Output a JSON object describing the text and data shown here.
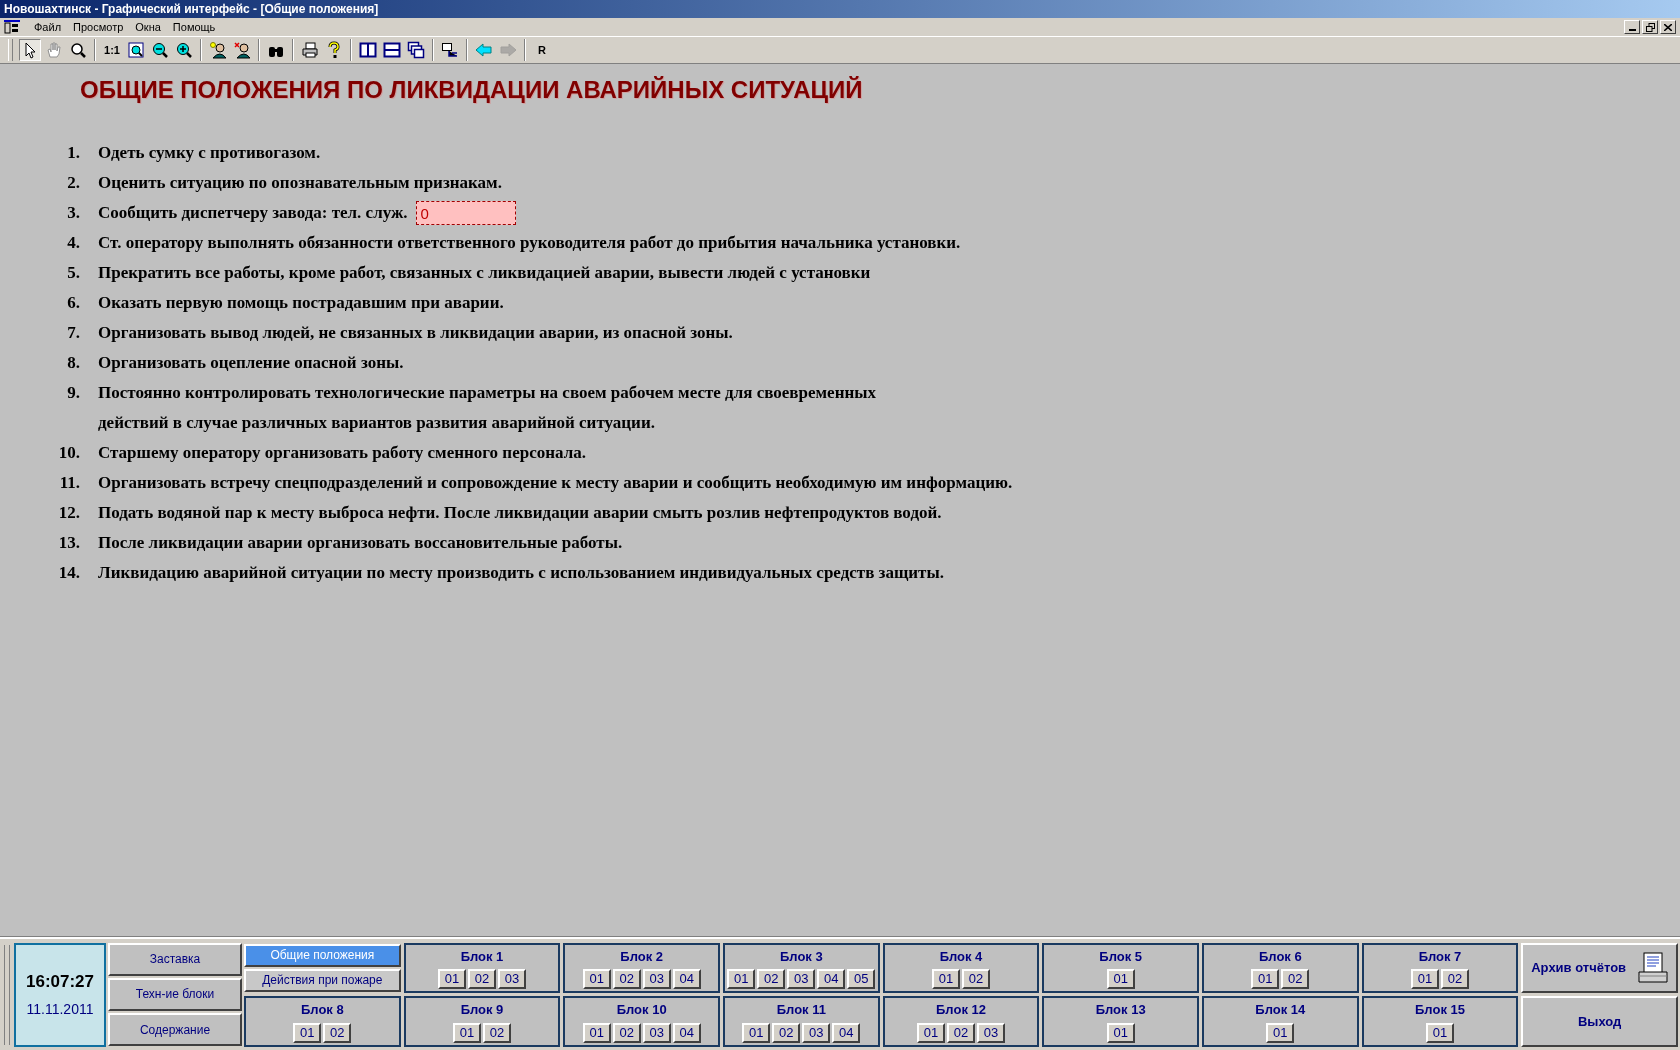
{
  "window": {
    "title": "Новошахтинск - Графический интерфейс - [Общие положения]"
  },
  "menu": [
    "Файл",
    "Просмотр",
    "Окна",
    "Помощь"
  ],
  "toolbar": [
    {
      "kind": "pointer",
      "on": true
    },
    {
      "kind": "hand",
      "on": false
    },
    {
      "kind": "magnifier",
      "on": false
    },
    {
      "kind": "sep"
    },
    {
      "kind": "label",
      "label": "1:1"
    },
    {
      "kind": "zoom-fit"
    },
    {
      "kind": "zoom-out"
    },
    {
      "kind": "zoom-in"
    },
    {
      "kind": "sep"
    },
    {
      "kind": "person-add"
    },
    {
      "kind": "person-remove"
    },
    {
      "kind": "sep"
    },
    {
      "kind": "binoculars"
    },
    {
      "kind": "sep"
    },
    {
      "kind": "printer"
    },
    {
      "kind": "help"
    },
    {
      "kind": "sep"
    },
    {
      "kind": "split-v"
    },
    {
      "kind": "split-h"
    },
    {
      "kind": "cascade"
    },
    {
      "kind": "sep"
    },
    {
      "kind": "tree"
    },
    {
      "kind": "sep"
    },
    {
      "kind": "back"
    },
    {
      "kind": "forward",
      "disabled": true
    },
    {
      "kind": "sep"
    },
    {
      "kind": "label",
      "label": "R"
    }
  ],
  "heading": "ОБЩИЕ ПОЛОЖЕНИЯ ПО ЛИКВИДАЦИИ АВАРИЙНЫХ СИТУАЦИЙ",
  "items": [
    {
      "number": "1.",
      "lines": [
        "Одеть сумку с противогазом."
      ]
    },
    {
      "number": "2.",
      "lines": [
        "Оценить ситуацию по опознавательным признакам."
      ]
    },
    {
      "number": "3.",
      "lines": [
        "Сообщить диспетчеру завода: тел. служ."
      ],
      "field": {
        "value": "0"
      }
    },
    {
      "number": "4.",
      "lines": [
        "Ст. оператору выполнять обязанности ответственного руководителя работ до прибытия начальника установки."
      ]
    },
    {
      "number": "5.",
      "lines": [
        "Прекратить все работы, кроме работ, связанных с ликвидацией аварии, вывести людей с установки"
      ]
    },
    {
      "number": "6.",
      "lines": [
        "Оказать первую помощь пострадавшим при аварии."
      ]
    },
    {
      "number": "7.",
      "lines": [
        "Организовать вывод людей, не связанных в ликвидации аварии, из опасной зоны."
      ]
    },
    {
      "number": "8.",
      "lines": [
        "Организовать оцепление опасной зоны."
      ]
    },
    {
      "number": "9.",
      "lines": [
        "Постоянно контролировать технологические параметры на своем рабочем месте для своевременных",
        "действий в случае различных вариантов развития аварийной ситуации."
      ]
    },
    {
      "number": "10.",
      "lines": [
        "Старшему оператору организовать работу сменного персонала."
      ]
    },
    {
      "number": "11.",
      "lines": [
        "Организовать встречу спецподразделений и сопровождение к месту аварии и сообщить необходимую им информацию."
      ]
    },
    {
      "number": "12.",
      "lines": [
        "Подать водяной пар к месту выброса нефти. После ликвидации аварии смыть розлив нефтепродуктов водой."
      ]
    },
    {
      "number": "13.",
      "lines": [
        "После ликвидации аварии организовать воссановительные работы."
      ]
    },
    {
      "number": "14.",
      "lines": [
        "Ликвидацию аварийной ситуации по месту производить с использованием индивидуальных средств защиты."
      ]
    }
  ],
  "bottom": {
    "time": "16:07:27",
    "date": "11.11.2011",
    "nav": [
      "Заставка",
      "Техн-ие блоки",
      "Содержание"
    ],
    "pages": [
      {
        "label": "Общие положения",
        "selected": true
      },
      {
        "label": "Действия при пожаре",
        "selected": false
      }
    ],
    "blocks": [
      {
        "name": "Блок 1",
        "codes": [
          "01",
          "02",
          "03"
        ]
      },
      {
        "name": "Блок 2",
        "codes": [
          "01",
          "02",
          "03",
          "04"
        ]
      },
      {
        "name": "Блок 3",
        "codes": [
          "01",
          "02",
          "03",
          "04",
          "05"
        ]
      },
      {
        "name": "Блок 4",
        "codes": [
          "01",
          "02"
        ]
      },
      {
        "name": "Блок 5",
        "codes": [
          "01"
        ]
      },
      {
        "name": "Блок 6",
        "codes": [
          "01",
          "02"
        ]
      },
      {
        "name": "Блок 7",
        "codes": [
          "01",
          "02"
        ]
      },
      {
        "name": "Блок 8",
        "codes": [
          "01",
          "02"
        ]
      },
      {
        "name": "Блок 9",
        "codes": [
          "01",
          "02"
        ]
      },
      {
        "name": "Блок 10",
        "codes": [
          "01",
          "02",
          "03",
          "04"
        ]
      },
      {
        "name": "Блок 11",
        "codes": [
          "01",
          "02",
          "03",
          "04"
        ]
      },
      {
        "name": "Блок 12",
        "codes": [
          "01",
          "02",
          "03"
        ]
      },
      {
        "name": "Блок 13",
        "codes": [
          "01"
        ]
      },
      {
        "name": "Блок 14",
        "codes": [
          "01"
        ]
      },
      {
        "name": "Блок 15",
        "codes": [
          "01"
        ]
      }
    ],
    "archive": "Архив отчётов",
    "exit": "Выход"
  }
}
